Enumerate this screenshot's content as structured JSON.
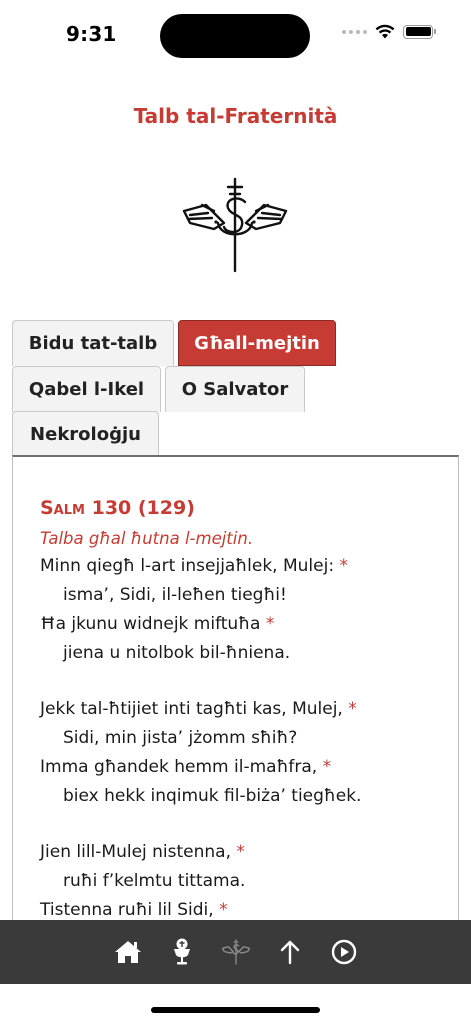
{
  "status": {
    "time": "9:31"
  },
  "header": {
    "title": "Talb tal-Fraternità"
  },
  "tabs": [
    {
      "label": "Bidu tat-talb",
      "active": false
    },
    {
      "label": "Għall-mejtin",
      "active": true
    },
    {
      "label": "Qabel l-Ikel",
      "active": false
    },
    {
      "label": "O Salvator",
      "active": false
    },
    {
      "label": "Nekroloġju",
      "active": false
    }
  ],
  "content": {
    "psalm_word": "Salm",
    "psalm_number": "130 (129)",
    "antiphon": "Talba għal ħutna l-mejtin.",
    "lines": [
      {
        "text": "Minn qiegħ l-art insejjaħlek, Mulej: ",
        "star": "*"
      },
      {
        "text": "isma’, Sidi, il-leħen tiegħi!"
      },
      {
        "text": "Ħa jkunu widnejk miftuħa ",
        "star": "*"
      },
      {
        "text": "jiena u nitolbok bil-ħniena."
      },
      {
        "text": "Jekk tal-ħtijiet inti tagħti kas, Mulej, ",
        "star": "*"
      },
      {
        "text": "Sidi, min jista’ jżomm sħiħ?"
      },
      {
        "text": "Imma għandek hemm il-maħfra, ",
        "star": "*"
      },
      {
        "text": "biex hekk inqimuk fil-biża’ tiegħek."
      },
      {
        "text": "Jien lill-Mulej nistenna, ",
        "star": "*"
      },
      {
        "text": "ruħi f’kelmtu tittama."
      },
      {
        "text": "Tistenna ruħi lil Sidi, ",
        "star": "*"
      }
    ]
  },
  "toolbar": {
    "icons": [
      "home-icon",
      "chalice-icon",
      "emblem-icon",
      "arrow-up-icon",
      "play-circle-icon"
    ]
  },
  "colors": {
    "accent": "#c63b34",
    "toolbar": "#3a3a3a"
  }
}
